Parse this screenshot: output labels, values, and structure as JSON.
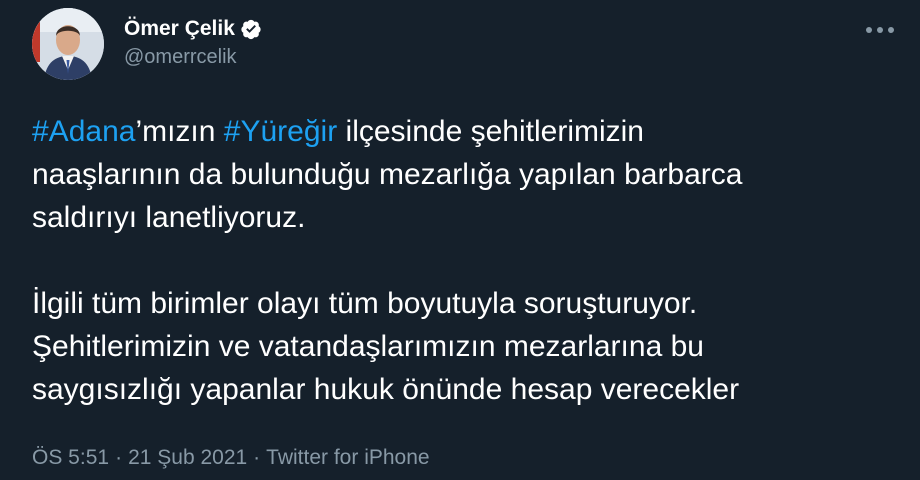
{
  "author": {
    "name": "Ömer Çelik",
    "handle": "@omerrcelik"
  },
  "tweet": {
    "paragraph1": {
      "hashtag1": "#Adana",
      "text1": "’mızın ",
      "hashtag2": "#Yüreğir",
      "text2": " ilçesinde şehitlerimizin",
      "line2": "naaşlarının da bulunduğu mezarlığa yapılan barbarca",
      "line3": "saldırıyı lanetliyoruz."
    },
    "paragraph2": {
      "line1": "İlgili tüm birimler olayı tüm boyutuyla soruşturuyor.",
      "line2": "Şehitlerimizin ve vatandaşlarımızın mezarlarına bu",
      "line3": "saygısızlığı yapanlar hukuk önünde hesap verecekler"
    }
  },
  "meta": {
    "time": "ÖS 5:51",
    "separator": "·",
    "date": "21 Şub 2021",
    "source": "Twitter for iPhone"
  },
  "colors": {
    "background": "#15202b",
    "hashtag": "#1da1f2",
    "secondary_text": "#8899a6",
    "verified_badge": "#ffffff"
  },
  "icons": [
    "verified-badge-icon",
    "more-options-icon"
  ]
}
